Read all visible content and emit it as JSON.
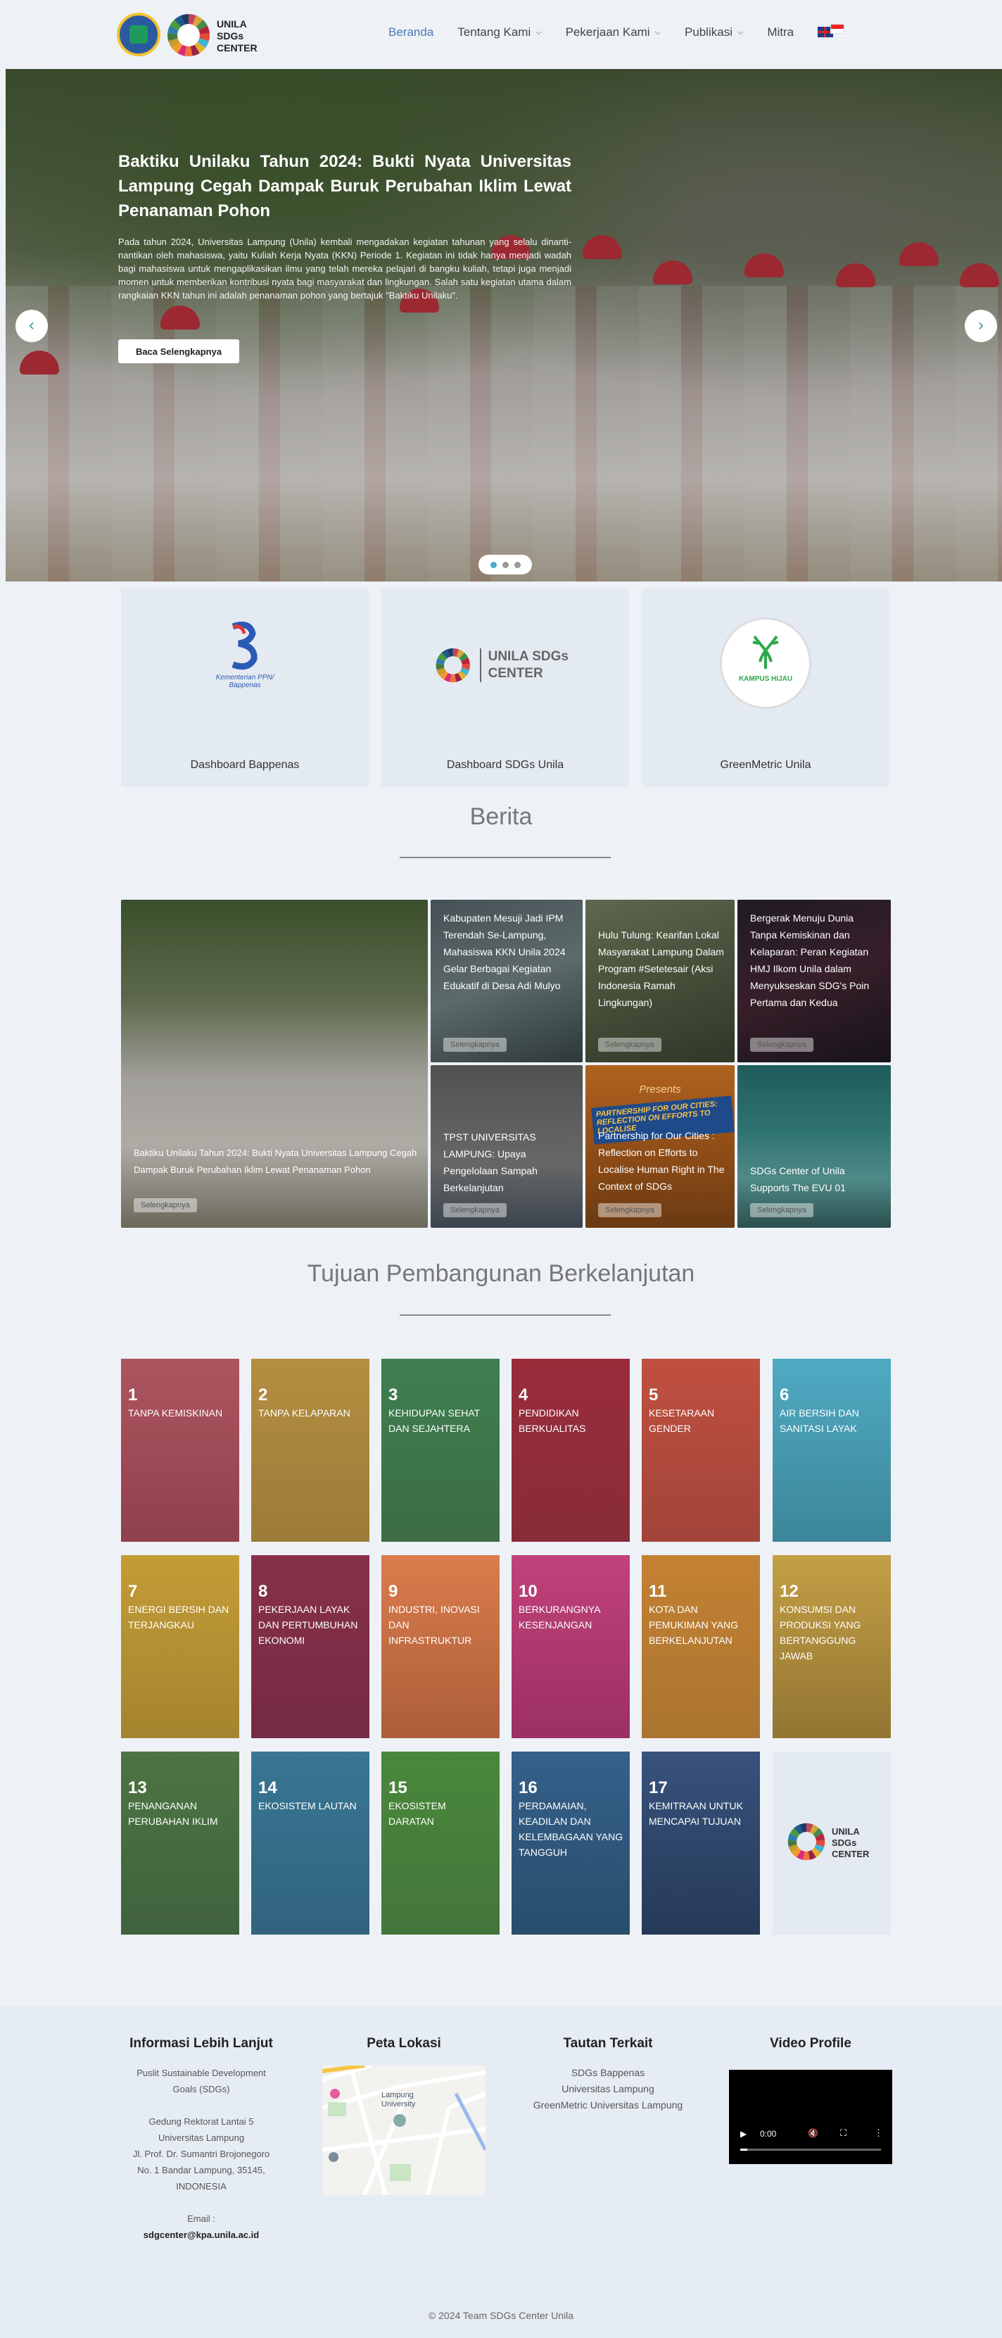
{
  "nav": {
    "logo_text": [
      "UNILA",
      "SDGs",
      "CENTER"
    ],
    "items": [
      {
        "label": "Beranda",
        "active": true,
        "dropdown": false
      },
      {
        "label": "Tentang Kami",
        "active": false,
        "dropdown": true
      },
      {
        "label": "Pekerjaan Kami",
        "active": false,
        "dropdown": true
      },
      {
        "label": "Publikasi",
        "active": false,
        "dropdown": true
      },
      {
        "label": "Mitra",
        "active": false,
        "dropdown": false
      }
    ]
  },
  "hero": {
    "title": "Baktiku Unilaku Tahun 2024: Bukti Nyata Universitas Lampung Cegah Dampak Buruk Perubahan Iklim Lewat Penanaman Pohon",
    "description": "Pada tahun 2024, Universitas Lampung (Unila) kembali mengadakan kegiatan tahunan yang selalu dinanti-nantikan oleh mahasiswa, yaitu Kuliah Kerja Nyata (KKN) Periode 1. Kegiatan ini tidak hanya menjadi wadah bagi mahasiswa untuk mengaplikasikan ilmu yang telah mereka pelajari di bangku kuliah, tetapi juga menjadi momen untuk memberikan kontribusi nyata bagi masyarakat dan lingkungan. Salah satu kegiatan utama dalam rangkaian KKN tahun ini adalah penanaman pohon yang bertajuk \"Baktiku Unilaku\".",
    "button": "Baca Selengkapnya",
    "prev": "‹",
    "next": "›"
  },
  "dashboards": [
    {
      "label": "Dashboard Bappenas",
      "logo_text": "Kementerian PPN/ Bappenas"
    },
    {
      "label": "Dashboard SDGs Unila",
      "logo_text": "UNILA SDGs CENTER"
    },
    {
      "label": "GreenMetric Unila",
      "logo_text": "KAMPUS HIJAU"
    }
  ],
  "news_section": {
    "title": "Berita",
    "more_label": "Selengkapnya",
    "featured": "Baktiku Unilaku Tahun 2024: Bukti Nyata Universitas Lampung Cegah Dampak Buruk Perubahan Iklim Lewat Penanaman Pohon",
    "items": [
      "Kabupaten Mesuji Jadi IPM Terendah Se-Lampung, Mahasiswa KKN Unila 2024 Gelar Berbagai Kegiatan Edukatif di Desa Adi Mulyo",
      "Hulu Tulung: Kearifan Lokal Masyarakat Lampung Dalam Program #Setetesair (Aksi Indonesia Ramah Lingkungan)",
      "Bergerak Menuju Dunia Tanpa Kemiskinan dan Kelaparan: Peran Kegiatan HMJ Ilkom Unila dalam Menyukseskan SDG's Poin Pertama dan Kedua",
      "TPST UNIVERSITAS LAMPUNG: Upaya Pengelolaan Sampah Berkelanjutan",
      "Partnership for Our Cities : Reflection on Efforts to Localise Human Right in The Context of SDGs",
      "SDGs Center of Unila Supports The EVU 01"
    ],
    "poster_text": "Presents",
    "poster_banner": "PARTNERSHIP FOR OUR CITIES: REFLECTION ON EFFORTS TO LOCALISE"
  },
  "sdg_section": {
    "title": "Tujuan Pembangunan Berkelanjutan",
    "goals": [
      {
        "num": "1",
        "name": "Tanpa Kemiskinan",
        "color": "#c4455a"
      },
      {
        "num": "2",
        "name": "Tanpa Kelaparan",
        "color": "#d9a43a"
      },
      {
        "num": "3",
        "name": "Kehidupan Sehat dan Sejahtera",
        "color": "#3f8c4e"
      },
      {
        "num": "4",
        "name": "Pendidikan Berkualitas",
        "color": "#b8243a"
      },
      {
        "num": "5",
        "name": "Kesetaraan Gender",
        "color": "#e24a3a"
      },
      {
        "num": "6",
        "name": "Air Bersih dan Sanitasi Layak",
        "color": "#3fb4d4"
      },
      {
        "num": "7",
        "name": "Energi Bersih dan Terjangkau",
        "color": "#e6b12a"
      },
      {
        "num": "8",
        "name": "Pekerjaan Layak dan Pertumbuhan Ekonomi",
        "color": "#9a2248"
      },
      {
        "num": "9",
        "name": "Industri, Inovasi dan Infrastruktur",
        "color": "#f1743a"
      },
      {
        "num": "10",
        "name": "Berkurangnya Kesenjangan",
        "color": "#d92a7a"
      },
      {
        "num": "11",
        "name": "Kota dan Pemukiman yang Berkelanjutan",
        "color": "#f19a2a"
      },
      {
        "num": "12",
        "name": "Konsumsi dan Produksi yang Bertanggung Jawab",
        "color": "#c99a2e"
      },
      {
        "num": "13",
        "name": "Penanganan Perubahan Iklim",
        "color": "#467a40"
      },
      {
        "num": "14",
        "name": "Ekosistem Lautan",
        "color": "#2d7eaa"
      },
      {
        "num": "15",
        "name": "Ekosistem Daratan",
        "color": "#4a9b3c"
      },
      {
        "num": "16",
        "name": "Perdamaian, Keadilan dan Kelembagaan yang Tangguh",
        "color": "#1f5a8a"
      },
      {
        "num": "17",
        "name": "Kemitraan untuk Mencapai Tujuan",
        "color": "#1a3a6a"
      }
    ],
    "logo_text": [
      "UNILA",
      "SDGs",
      "CENTER"
    ]
  },
  "footer": {
    "info_title": "Informasi Lebih Lanjut",
    "info_lines": [
      "Puslit Sustainable Development",
      "Goals (SDGs)",
      "",
      "Gedung Rektorat Lantai 5",
      "Universitas Lampung",
      "Jl. Prof. Dr. Sumantri Brojonegoro",
      "No. 1 Bandar Lampung, 35145,",
      "INDONESIA",
      "",
      "Email :"
    ],
    "email": "sdgcenter@kpa.unila.ac.id",
    "map_title": "Peta Lokasi",
    "map_label": "Lampung University",
    "links_title": "Tautan Terkait",
    "links": [
      "SDGs Bappenas",
      "Universitas Lampung",
      "GreenMetric Universitas Lampung"
    ],
    "video_title": "Video Profile",
    "video_time": "0:00",
    "copyright": "© 2024 Team SDGs Center Unila"
  }
}
